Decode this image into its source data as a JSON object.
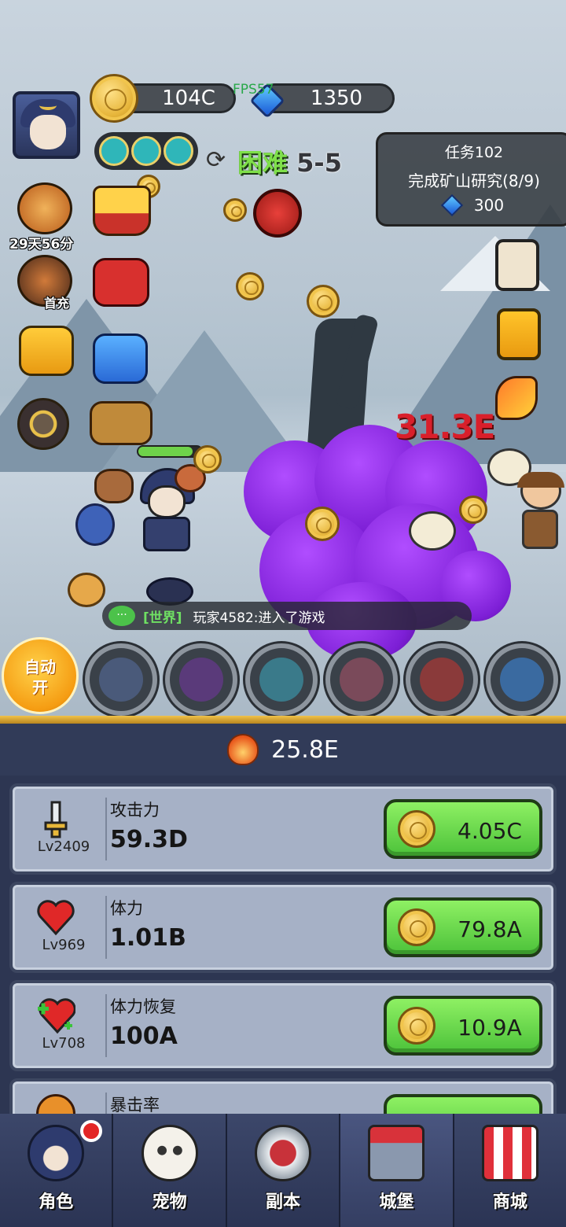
{
  "hud": {
    "gold": "104C",
    "gems": "1350",
    "fps": "FPS57",
    "difficulty_label": "困难",
    "stage": "5-5"
  },
  "quest": {
    "title": "任务102",
    "desc": "完成矿山研究(8/9)",
    "reward": "300"
  },
  "side": {
    "event_timer": "29天56分",
    "first_charge": "首充"
  },
  "battle": {
    "damage_number": "31.3E"
  },
  "chat": {
    "bubble": "···",
    "channel": "[世界]",
    "message": "玩家4582:进入了游戏"
  },
  "auto": {
    "line1": "自动",
    "line2": "开"
  },
  "power": "25.8E",
  "upgrades": [
    {
      "name": "攻击力",
      "level": "Lv2409",
      "value": "59.3D",
      "cost": "4.05C"
    },
    {
      "name": "体力",
      "level": "Lv969",
      "value": "1.01B",
      "cost": "79.8A"
    },
    {
      "name": "体力恢复",
      "level": "Lv708",
      "value": "100A",
      "cost": "10.9A"
    },
    {
      "name": "暴击率",
      "level": "",
      "value": "",
      "cost": ""
    }
  ],
  "nav": [
    {
      "label": "角色"
    },
    {
      "label": "宠物"
    },
    {
      "label": "副本"
    },
    {
      "label": "城堡"
    },
    {
      "label": "商城"
    }
  ],
  "colors": {
    "buy_green": "#6bd64a",
    "damage_red": "#d91f2b",
    "chat_channel": "#6fe063",
    "panel_bg": "#2d3652"
  },
  "icons": [
    "sword-icon",
    "heart-icon",
    "heart-plus-icon",
    "gem-icon",
    "coin-icon",
    "flame-icon",
    "refresh-icon",
    "chat-icon"
  ]
}
